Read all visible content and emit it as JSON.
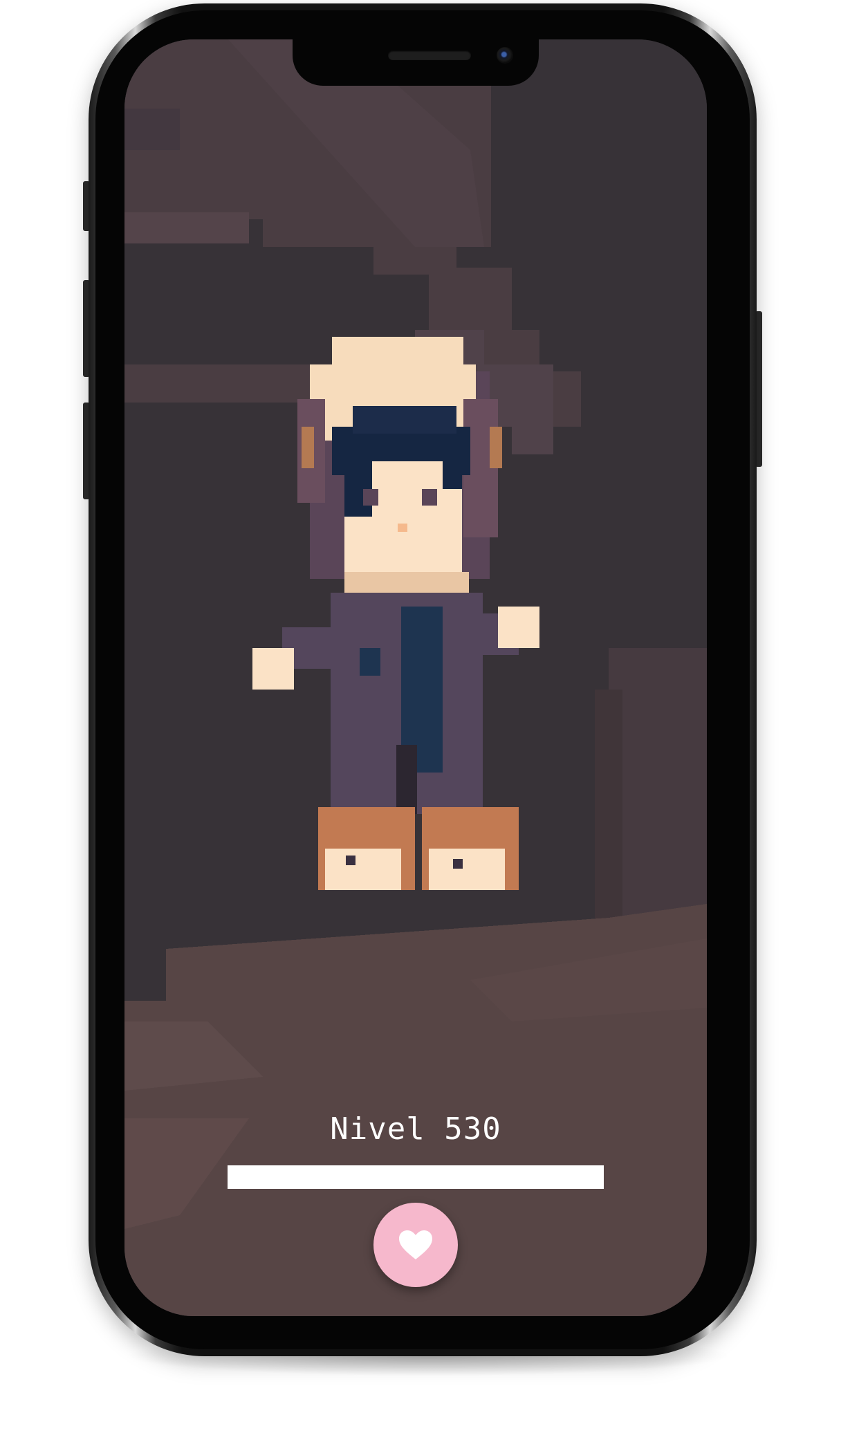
{
  "game": {
    "level_label": "Nivel 530",
    "level_progress": 1.0,
    "like_button_icon": "heart-icon"
  },
  "colors": {
    "background": "#373237",
    "floor": "#574545",
    "accent_pink": "#f6b8cc",
    "progress_bar": "#ffffff"
  }
}
